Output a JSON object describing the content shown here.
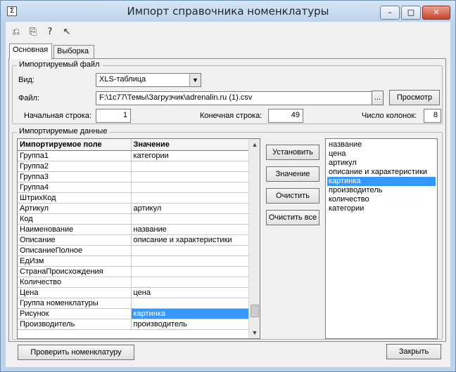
{
  "window": {
    "title": "Импорт справочника номенклатуры",
    "controls": {
      "minimize": "–",
      "maximize": "□",
      "close": "✕"
    }
  },
  "toolbar": {
    "icons": [
      "open-icon",
      "save-icon",
      "help-icon",
      "context-help-icon"
    ]
  },
  "tabs": [
    {
      "label": "Основная",
      "active": true
    },
    {
      "label": "Выборка",
      "active": false
    }
  ],
  "file_group": {
    "legend": "Импортируемый файл",
    "type_label": "Вид:",
    "type_value": "XLS-таблица",
    "file_label": "Файл:",
    "file_value": "F:\\1c77\\Темы\\Загрузчик\\adrenalin.ru (1).csv",
    "browse_label": "...",
    "preview_label": "Просмотр",
    "start_row_label": "Начальная строка:",
    "start_row_value": "1",
    "end_row_label": "Конечная строка:",
    "end_row_value": "49",
    "columns_label": "Число колонок:",
    "columns_value": "8"
  },
  "data_group": {
    "legend": "Импортируемые данные",
    "columns": [
      "Импортируемое поле",
      "Значение"
    ],
    "rows": [
      {
        "field": "Группа1",
        "value": "категории"
      },
      {
        "field": "Группа2",
        "value": ""
      },
      {
        "field": "Группа3",
        "value": ""
      },
      {
        "field": "Группа4",
        "value": ""
      },
      {
        "field": "ШтрихКод",
        "value": ""
      },
      {
        "field": "Артикул",
        "value": "артикул"
      },
      {
        "field": "Код",
        "value": ""
      },
      {
        "field": "Наименование",
        "value": "название"
      },
      {
        "field": "Описание",
        "value": "описание и характеристики"
      },
      {
        "field": "ОписаниеПолное",
        "value": ""
      },
      {
        "field": "ЕдИзм",
        "value": ""
      },
      {
        "field": "СтранаПроисхождения",
        "value": ""
      },
      {
        "field": "Количество",
        "value": ""
      },
      {
        "field": "Цена",
        "value": "цена"
      },
      {
        "field": "Группа номенклатуры",
        "value": ""
      },
      {
        "field": "Рисунок",
        "value": "картинка"
      },
      {
        "field": "Производитель",
        "value": "производитель"
      }
    ],
    "selected_row": 15,
    "buttons": {
      "set": "Установить",
      "value": "Значение",
      "clear": "Очистить",
      "clear_all": "Очистить все"
    },
    "source_columns": [
      "название",
      "цена",
      "артикул",
      "описание и характеристики",
      "картинка",
      "производитель",
      "количество",
      "категории"
    ],
    "selected_source": 4
  },
  "footer": {
    "check_label": "Проверить номенклатуру",
    "close_label": "Закрыть"
  }
}
